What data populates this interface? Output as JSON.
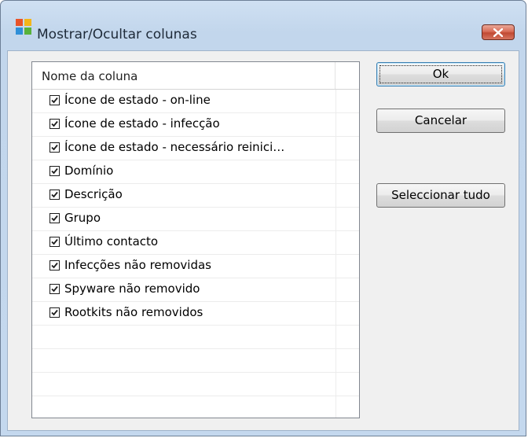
{
  "window": {
    "title": "Mostrar/Ocultar colunas",
    "app_icon": "avg-logo-icon",
    "close_icon": "close-icon"
  },
  "columns_list": {
    "header": "Nome da coluna",
    "items": [
      {
        "label": "Ícone de estado - on-line",
        "checked": true
      },
      {
        "label": "Ícone de estado - infecção",
        "checked": true
      },
      {
        "label": "Ícone de estado - necessário reinici…",
        "checked": true
      },
      {
        "label": "Domínio",
        "checked": true
      },
      {
        "label": "Descrição",
        "checked": true
      },
      {
        "label": "Grupo",
        "checked": true
      },
      {
        "label": "Último contacto",
        "checked": true
      },
      {
        "label": "Infecções não removidas",
        "checked": true
      },
      {
        "label": "Spyware não removido",
        "checked": true
      },
      {
        "label": "Rootkits não removidos",
        "checked": true
      }
    ]
  },
  "buttons": {
    "ok_label": "Ok",
    "cancel_label": "Cancelar",
    "select_all_label": "Seleccionar tudo"
  },
  "colors": {
    "titlebar": "#c6daef",
    "close_button": "#c8553f",
    "dialog_background": "#f0f0f0"
  }
}
